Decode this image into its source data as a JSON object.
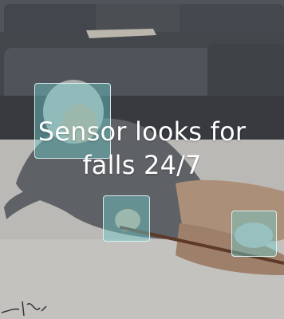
{
  "card": {
    "headline_line1": "Sensor looks for",
    "headline_line2": "falls 24/7"
  },
  "scene": {
    "description_icon": "elderly-fall-photo",
    "detection_boxes": 3
  },
  "colors": {
    "detection_fill": "#6ecdcd",
    "headline": "#ffffff"
  }
}
